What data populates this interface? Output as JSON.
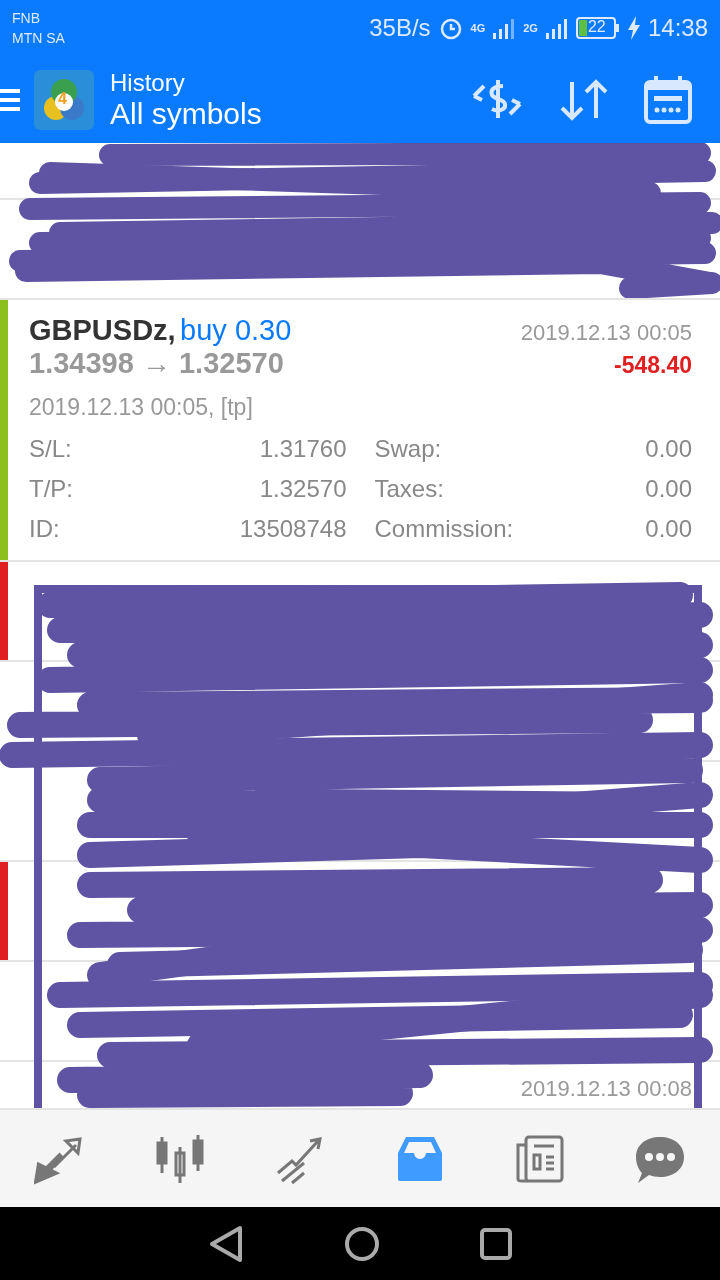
{
  "status_bar": {
    "carriers": [
      "FNB",
      "MTN SA"
    ],
    "speed": "35B/s",
    "network_1": "4G",
    "network_2": "2G",
    "battery": "22",
    "time": "14:38"
  },
  "app_bar": {
    "logo_badge": "4",
    "title": "History",
    "subtitle": "All symbols"
  },
  "rows": [
    {
      "kind": "hidden"
    },
    {
      "kind": "hidden"
    },
    {
      "kind": "expanded",
      "color": "#8cc01e",
      "symbol": "GBPUSDz,",
      "side": "buy 0.30",
      "time": "2019.12.13 00:05",
      "prices": "1.34398 → 1.32570",
      "profit": "-548.40",
      "opened": "2019.12.13 00:05, [tp]",
      "details": [
        {
          "label": "S/L:",
          "value": "1.31760"
        },
        {
          "label": "Swap:",
          "value": "0.00"
        },
        {
          "label": "T/P:",
          "value": "1.32570"
        },
        {
          "label": "Taxes:",
          "value": "0.00"
        },
        {
          "label": "ID:",
          "value": "13508748"
        },
        {
          "label": "Commission:",
          "value": "0.00"
        }
      ]
    },
    {
      "kind": "hidden",
      "color": "#e02020"
    },
    {
      "kind": "hidden"
    },
    {
      "kind": "hidden"
    },
    {
      "kind": "hidden",
      "color": "#e02020"
    },
    {
      "kind": "hidden"
    },
    {
      "kind": "hidden",
      "time": "2019.12.13 00:08"
    }
  ],
  "bottom_nav": [
    {
      "kind": "trade",
      "selected": false
    },
    {
      "kind": "chart",
      "selected": false
    },
    {
      "kind": "trend",
      "selected": false
    },
    {
      "kind": "history",
      "selected": true
    },
    {
      "kind": "news",
      "selected": false
    },
    {
      "kind": "chat",
      "selected": false
    }
  ],
  "system_nav": [
    {
      "kind": "back"
    },
    {
      "kind": "home"
    },
    {
      "kind": "recent"
    }
  ]
}
